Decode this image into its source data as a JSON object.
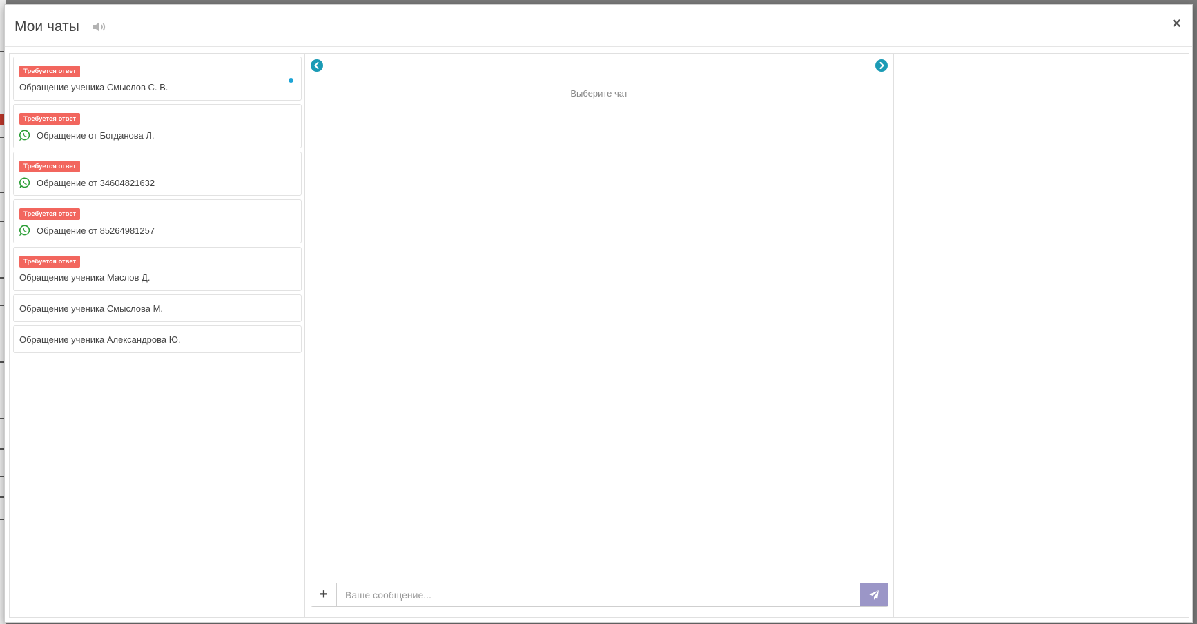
{
  "modal": {
    "title": "Мои чаты",
    "close_label": "×"
  },
  "chats": [
    {
      "badge": "Требуется ответ",
      "name": "Обращение ученика Смыслов С. В.",
      "icon": null,
      "unread": true
    },
    {
      "badge": "Требуется ответ",
      "name": "Обращение от Богданова Л.",
      "icon": "whatsapp-icon",
      "unread": false
    },
    {
      "badge": "Требуется ответ",
      "name": "Обращение от 34604821632",
      "icon": "whatsapp-icon",
      "unread": false
    },
    {
      "badge": "Требуется ответ",
      "name": "Обращение от 85264981257",
      "icon": "whatsapp-icon",
      "unread": false
    },
    {
      "badge": "Требуется ответ",
      "name": "Обращение ученика Маслов Д.",
      "icon": null,
      "unread": false
    },
    {
      "badge": null,
      "name": "Обращение ученика Смыслова М.",
      "icon": null,
      "unread": false
    },
    {
      "badge": null,
      "name": "Обращение ученика Александрова Ю.",
      "icon": null,
      "unread": false
    }
  ],
  "conversation": {
    "empty_text": "Выберите чат"
  },
  "composer": {
    "add_label": "+",
    "placeholder": "Ваше сообщение..."
  },
  "colors": {
    "badge": "#f2665e",
    "nav_arrow": "#1b9bb5",
    "whatsapp": "#2a9d35",
    "send_button": "#9b96c7",
    "unread_dot": "#1da4d6"
  }
}
